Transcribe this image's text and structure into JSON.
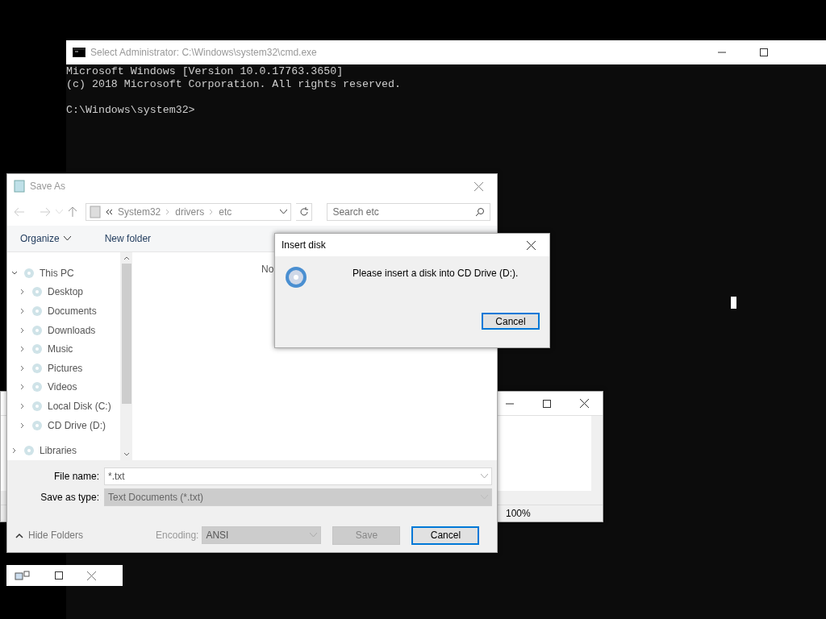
{
  "cmd_window": {
    "title": "Select Administrator: C:\\Windows\\system32\\cmd.exe",
    "output_lines": [
      "Microsoft Windows [Version 10.0.17763.3650]",
      "(c) 2018 Microsoft Corporation. All rights reserved."
    ],
    "prompt": "C:\\Windows\\system32>"
  },
  "notepad_window": {
    "zoom": "100%"
  },
  "save_dialog": {
    "title": "Save As",
    "path": [
      "System32",
      "drivers",
      "etc"
    ],
    "search_placeholder": "Search etc",
    "toolbar": [
      "Organize",
      "New folder"
    ],
    "tree": [
      {
        "label": "This PC",
        "expanded": true,
        "children": [
          {
            "label": "Desktop",
            "expanded": false
          },
          {
            "label": "Documents",
            "expanded": false
          },
          {
            "label": "Downloads",
            "expanded": false
          },
          {
            "label": "Music",
            "expanded": false
          },
          {
            "label": "Pictures",
            "expanded": false
          },
          {
            "label": "Videos",
            "expanded": false
          },
          {
            "label": "Local Disk (C:)",
            "expanded": false
          },
          {
            "label": "CD Drive (D:)",
            "expanded": false
          }
        ]
      },
      {
        "label": "Libraries",
        "expanded": false
      }
    ],
    "empty_message": "No",
    "file_name_label": "File name:",
    "file_name": "*.txt",
    "type_label": "Save as type:",
    "type_value": "Text Documents (*.txt)",
    "hide_folders": "Hide Folders",
    "encoding_label": "Encoding:",
    "encoding_value": "ANSI",
    "encoding_disabled": true,
    "buttons": [
      {
        "label": "Save",
        "disabled": true
      },
      {
        "label": "Cancel",
        "disabled": false
      }
    ]
  },
  "insert_disk_dialog": {
    "title": "Insert disk",
    "message": "Please insert a disk into CD Drive (D:).",
    "button": "Cancel"
  }
}
